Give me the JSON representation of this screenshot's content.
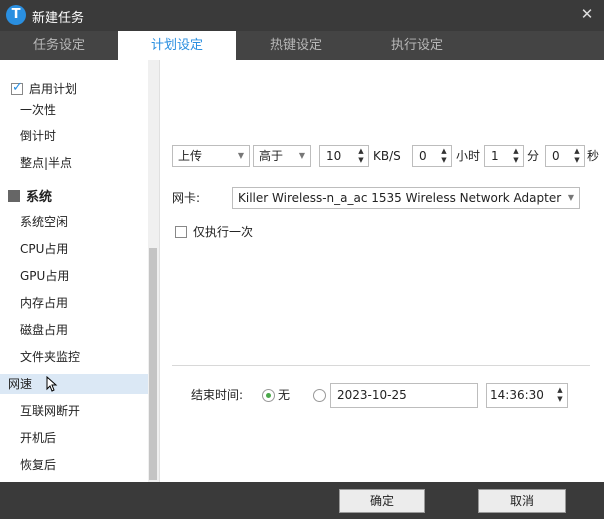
{
  "window": {
    "title": "新建任务",
    "logo": "T"
  },
  "tabs": [
    {
      "label": "任务设定",
      "active": false
    },
    {
      "label": "计划设定",
      "active": true
    },
    {
      "label": "热键设定",
      "active": false
    },
    {
      "label": "执行设定",
      "active": false
    }
  ],
  "sidebar": {
    "enable_label": "启用计划",
    "top_items": [
      "一次性",
      "倒计时",
      "整点|半点"
    ],
    "group_label": "系统",
    "items": [
      "系统空闲",
      "CPU占用",
      "GPU占用",
      "内存占用",
      "磁盘占用",
      "文件夹监控",
      "网速",
      "互联网断开",
      "开机后",
      "恢复后"
    ],
    "selected_item": "网速"
  },
  "speed": {
    "direction": "上传",
    "comparison": "高于",
    "rate_value": "10",
    "rate_unit": "KB/S",
    "hours_value": "0",
    "hours_unit": "小时",
    "minutes_value": "1",
    "minutes_unit": "分",
    "seconds_value": "0",
    "seconds_unit": "秒"
  },
  "nic": {
    "label": "网卡:",
    "value": "Killer Wireless-n_a_ac 1535 Wireless Network Adapter"
  },
  "once": {
    "label": "仅执行一次",
    "checked": false
  },
  "end": {
    "label": "结束时间:",
    "none_label": "无",
    "date": "2023-10-25",
    "time": "14:36:30"
  },
  "footer": {
    "ok_label": "确定",
    "cancel_label": "取消"
  },
  "colors": {
    "accent": "#2a8fe0",
    "titlebar": "#3a3a3a",
    "radio_on": "#4aa84a",
    "selected_bg": "#dbe8f5"
  }
}
